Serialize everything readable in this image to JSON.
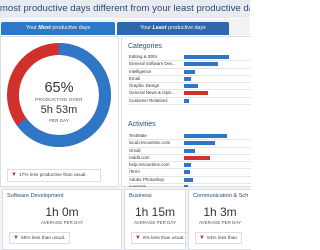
{
  "headline": "r most productive days different from your least productive days?",
  "tabs": [
    {
      "prefix": "Your ",
      "emph": "Most",
      "suffix": " productive days"
    },
    {
      "prefix": "Your ",
      "emph": "Least",
      "suffix": " productive days"
    }
  ],
  "summary": {
    "percent": "65%",
    "percent_label": "PRODUCTIVE OVER",
    "duration": "5h 53m",
    "duration_label": "PER DAY",
    "note": "17% less productive than usual.",
    "productive_fraction": 0.65,
    "ring_colors": {
      "productive": "#2e77c7",
      "rest": "#d0312d"
    }
  },
  "categories": {
    "title": "Categories",
    "items": [
      {
        "label": "Editing & IDEs",
        "color": "#2e77c7",
        "value": 0.72
      },
      {
        "label": "General Software Dev...",
        "color": "#2e77c7",
        "value": 0.55
      },
      {
        "label": "Intelligence",
        "color": "#2e77c7",
        "value": 0.18
      },
      {
        "label": "Email",
        "color": "#2e77c7",
        "value": 0.12
      },
      {
        "label": "Graphic Design",
        "color": "#2e77c7",
        "value": 0.22
      },
      {
        "label": "General News & Opin...",
        "color": "#d0312d",
        "value": 0.38
      },
      {
        "label": "Customer Relations",
        "color": "#2e77c7",
        "value": 0.08
      }
    ]
  },
  "activities": {
    "title": "Activities",
    "items": [
      {
        "label": "TextMate",
        "color": "#2e77c7",
        "value": 0.7
      },
      {
        "label": "local.rescuetime.com",
        "color": "#2e77c7",
        "value": 0.5
      },
      {
        "label": "Gmail",
        "color": "#2e77c7",
        "value": 0.18
      },
      {
        "label": "reddit.com",
        "color": "#d0312d",
        "value": 0.42
      },
      {
        "label": "help.rescuetime.com",
        "color": "#2e77c7",
        "value": 0.12
      },
      {
        "label": "iTerm",
        "color": "#2e77c7",
        "value": 0.1
      },
      {
        "label": "Adobe Photoshop",
        "color": "#2e77c7",
        "value": 0.14
      },
      {
        "label": "evernote",
        "color": "#2e77c7",
        "value": 0.06
      }
    ]
  },
  "cards": [
    {
      "title": "Software Development",
      "value": "1h 0m",
      "label": "AVERAGE PER DAY",
      "note": "55% less than usual."
    },
    {
      "title": "Business",
      "value": "1h 15m",
      "label": "AVERAGE PER DAY",
      "note": "8% less than usual."
    },
    {
      "title": "Communication & Sch",
      "value": "1h 3m",
      "label": "AVERAGE PER DAY",
      "note": "54% less than"
    }
  ]
}
